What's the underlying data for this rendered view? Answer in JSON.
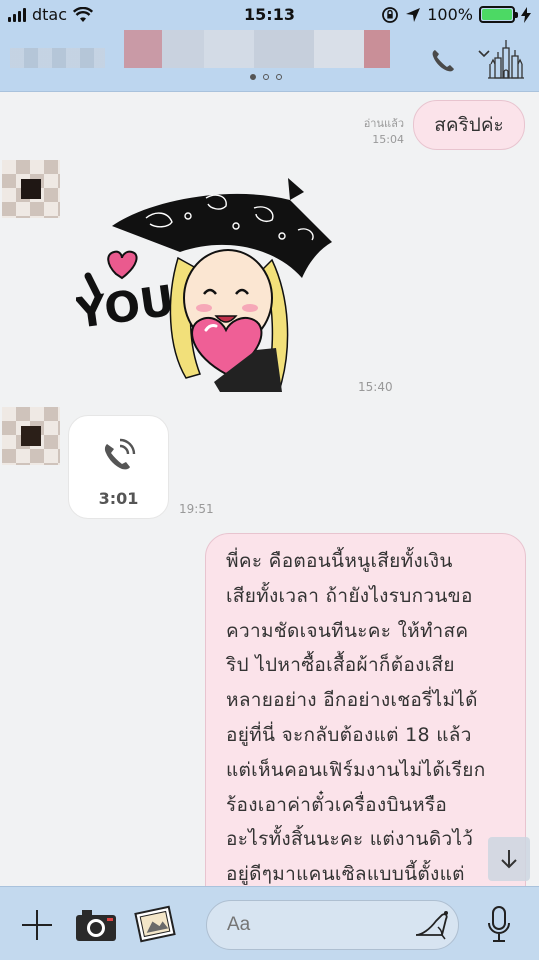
{
  "status_bar": {
    "carrier": "dtac",
    "time": "15:13",
    "battery_percent": "100%",
    "battery_level": 1.0
  },
  "header": {
    "icons": [
      "phone-icon",
      "castle-icon"
    ]
  },
  "messages": {
    "outgoing_1": {
      "read_label": "อ่านแล้ว",
      "time": "15:04",
      "text": "สคริปค่ะ"
    },
    "sticker": {
      "text": "I YOU",
      "time": "15:40"
    },
    "call": {
      "duration": "3:01",
      "time": "19:51"
    },
    "outgoing_2": {
      "lines": [
        "พี่คะ คือตอนนี้หนูเสียทั้งเงิน",
        "เสียทั้งเวลา ถ้ายังไงรบกวนขอ",
        "ความชัดเจนทีนะคะ ให้ทำสค",
        "ริป ไปหาซื้อเสื้อผ้าก็ต้องเสีย",
        "หลายอย่าง อีกอย่างเชอรี่ไม่ได้",
        "อยู่ที่นี่ จะกลับต้องแต่ 18 แล้ว",
        "แต่เห็นคอนเฟิร์มงานไม่ได้เรียก",
        "ร้องเอาค่าตั๋วเครื่องบินหรือ",
        "อะไรทั้งสิ้นนะคะ แต่งานดิวไว้",
        "อยู่ดีๆมาแคนเซิลแบบนี้ตั้งแต่"
      ]
    }
  },
  "input_bar": {
    "placeholder": "Aa",
    "icons": [
      "plus-icon",
      "camera-icon",
      "photo-icon",
      "sticker-shoe-icon",
      "microphone-icon"
    ]
  },
  "colors": {
    "header_bg": "#bdd6ef",
    "outgoing_bubble": "#fbe3ea",
    "incoming_bubble": "#ffffff",
    "chat_bg": "#f1f2f3"
  }
}
